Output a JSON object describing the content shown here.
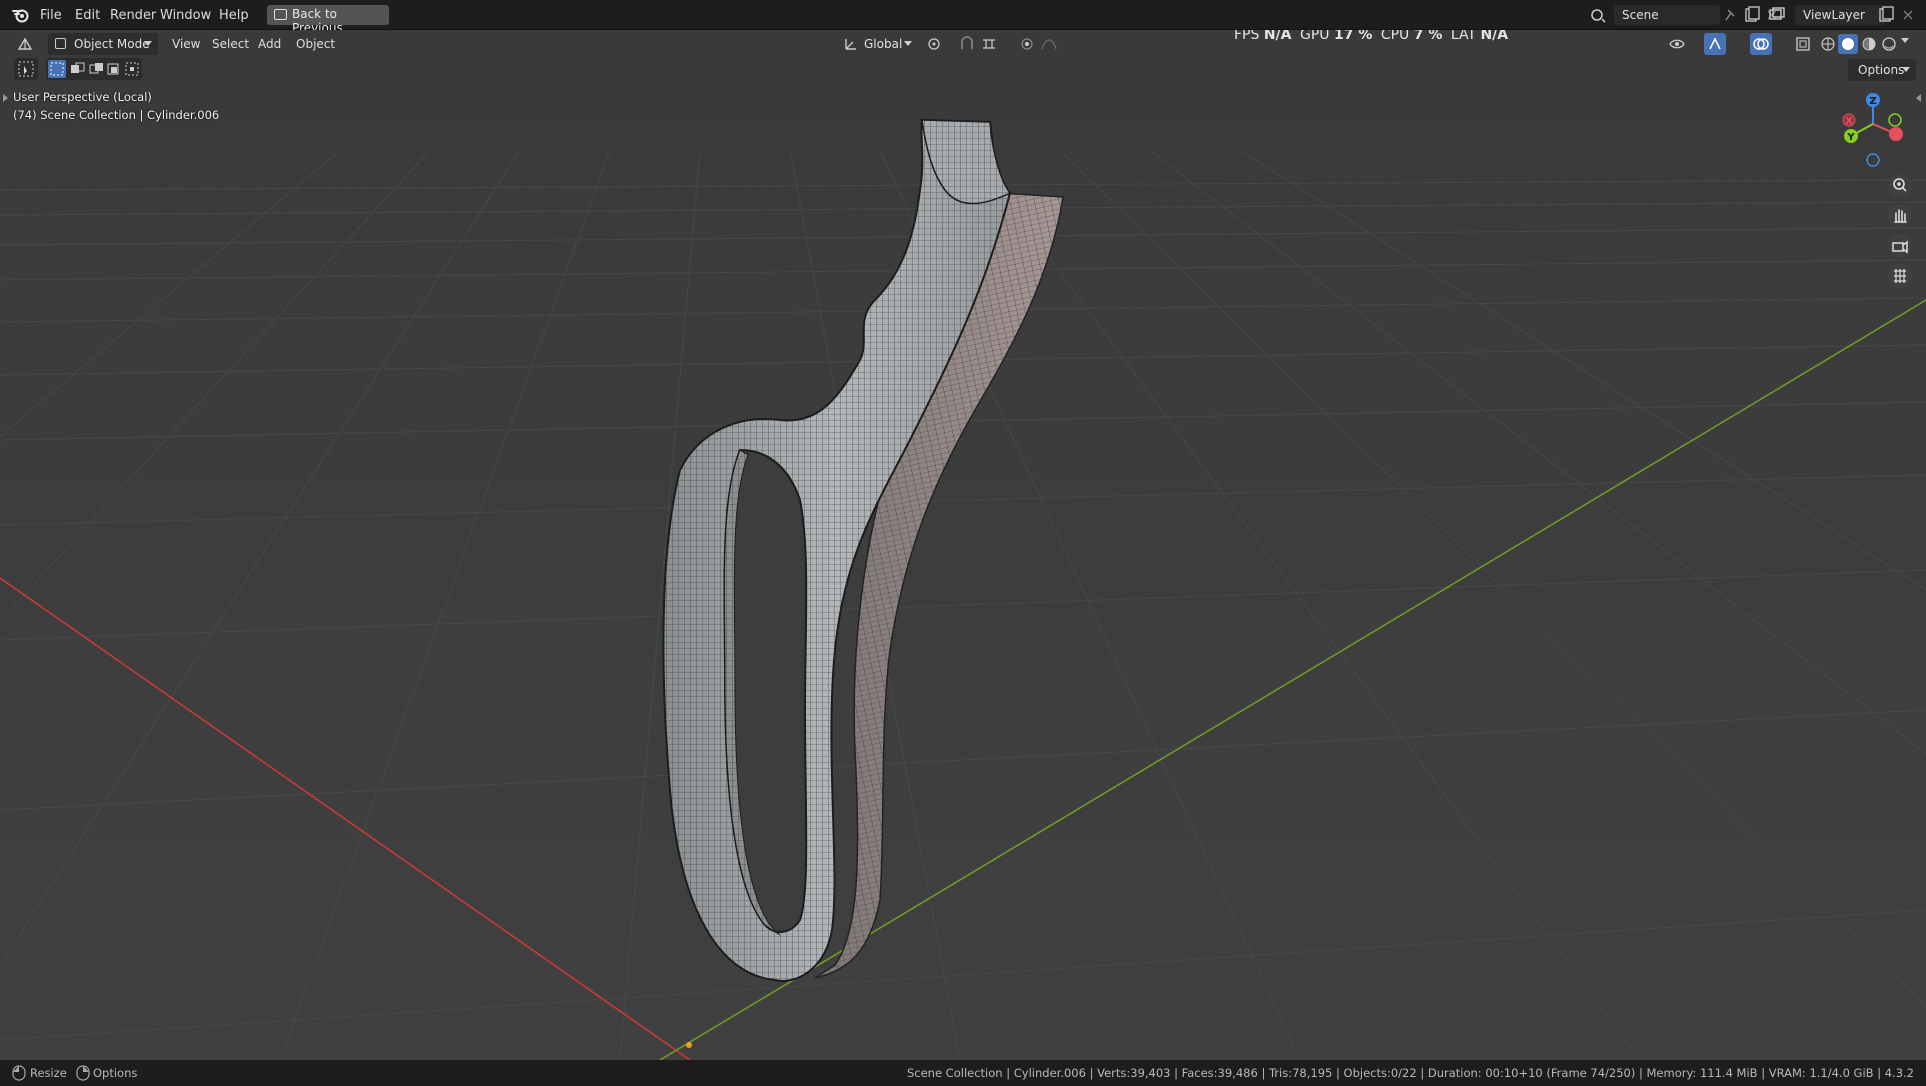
{
  "menubar": {
    "items": [
      "File",
      "Edit",
      "Render",
      "Window",
      "Help"
    ],
    "back_button": "Back to Previous",
    "scene_label": "Scene",
    "viewlayer_label": "ViewLayer"
  },
  "viewport_header": {
    "mode": "Object Mode",
    "menus": [
      "View",
      "Select",
      "Add",
      "Object"
    ],
    "transform_orientation": "Global",
    "options": "Options"
  },
  "perf": {
    "fps_label": "FPS",
    "fps_value": "N/A",
    "gpu_label": "GPU",
    "gpu_value": "17 %",
    "cpu_label": "CPU",
    "cpu_value": "7 %",
    "lat_label": "LAT",
    "lat_value": "N/A"
  },
  "overlay": {
    "view_name": "User Perspective (Local)",
    "collection_info": "(74) Scene Collection | Cylinder.006"
  },
  "gizmo": {
    "z": "Z",
    "x": "X",
    "y": "Y"
  },
  "statusbar": {
    "left_1": "Resize",
    "left_2": "Options",
    "right": "Scene Collection | Cylinder.006 | Verts:39,403 | Faces:39,486 | Tris:78,195 | Objects:0/22 | Duration: 00:10+10 (Frame 74/250) | Memory: 111.4 MiB | VRAM: 1.1/4.0 GiB | 4.3.2"
  },
  "colors": {
    "viewport_bg": "#3d3d3d",
    "x_axis": "#c83a3a",
    "y_axis": "#6e9a2c",
    "gizmo_x": "#e74f5c",
    "gizmo_y": "#8acd1d",
    "gizmo_z": "#3a8ae8",
    "accent": "#4772b3"
  }
}
